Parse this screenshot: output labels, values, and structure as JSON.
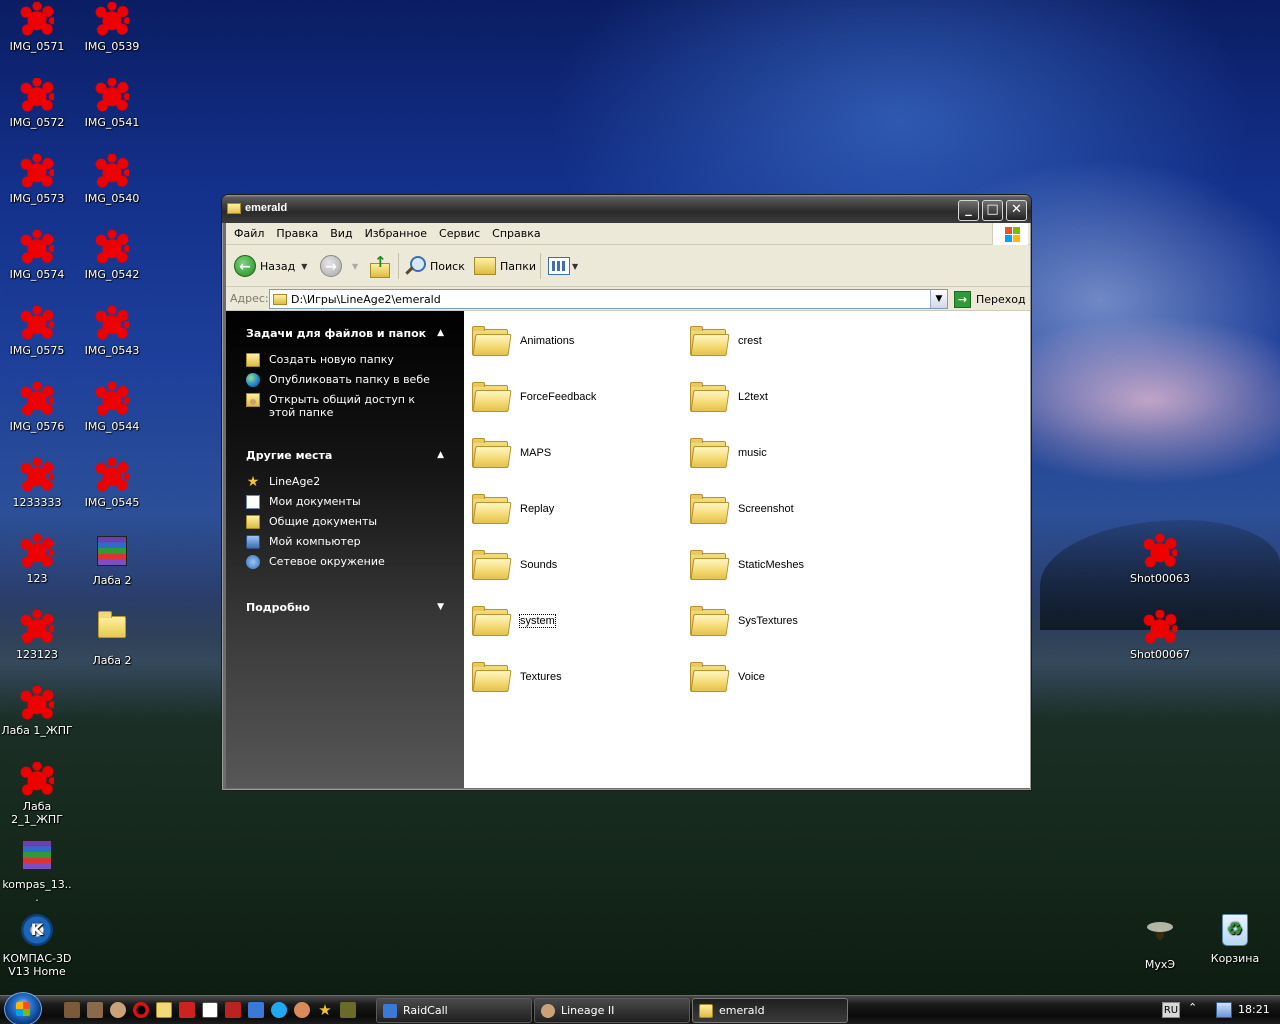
{
  "desktop": {
    "icons": [
      {
        "label": "IMG_0571",
        "icon": "image-icon"
      },
      {
        "label": "IMG_0539",
        "icon": "image-icon"
      },
      {
        "label": "IMG_0572",
        "icon": "image-icon"
      },
      {
        "label": "IMG_0541",
        "icon": "image-icon"
      },
      {
        "label": "IMG_0573",
        "icon": "image-icon"
      },
      {
        "label": "IMG_0540",
        "icon": "image-icon"
      },
      {
        "label": "IMG_0574",
        "icon": "image-icon"
      },
      {
        "label": "IMG_0542",
        "icon": "image-icon"
      },
      {
        "label": "IMG_0575",
        "icon": "image-icon"
      },
      {
        "label": "IMG_0543",
        "icon": "image-icon"
      },
      {
        "label": "IMG_0576",
        "icon": "image-icon"
      },
      {
        "label": "IMG_0544",
        "icon": "image-icon"
      },
      {
        "label": "1233333",
        "icon": "image-icon"
      },
      {
        "label": "IMG_0545",
        "icon": "image-icon"
      },
      {
        "label": "123",
        "icon": "image-icon"
      },
      {
        "label": "Лаба 2",
        "icon": "archive-icon"
      },
      {
        "label": "123123",
        "icon": "image-icon"
      },
      {
        "label": "Лаба 2",
        "icon": "folder-icon"
      },
      {
        "label": "Лаба 1_ЖПГ",
        "icon": "image-icon"
      },
      {
        "label": "Лаба 2_1_ЖПГ",
        "icon": "image-icon"
      },
      {
        "label": "kompas_13...",
        "icon": "archive-icon"
      },
      {
        "label": "КОМПАС-3D V13 Home",
        "icon": "kompas-icon"
      },
      {
        "label": "Shot00063",
        "icon": "image-icon"
      },
      {
        "label": "Shot00067",
        "icon": "image-icon"
      },
      {
        "label": "МухЭ",
        "icon": "fly-icon"
      },
      {
        "label": "Корзина",
        "icon": "recycle-bin-icon"
      }
    ]
  },
  "window": {
    "title": "emerald",
    "menu": [
      "Файл",
      "Правка",
      "Вид",
      "Избранное",
      "Сервис",
      "Справка"
    ],
    "toolbar": {
      "back_label": "Назад",
      "search_label": "Поиск",
      "folders_label": "Папки"
    },
    "address": {
      "label": "Адрес:",
      "value": "D:\\Игры\\LineAge2\\emerald",
      "go_label": "Переход"
    },
    "taskpane": {
      "file_tasks": {
        "title": "Задачи для файлов и папок",
        "items": [
          {
            "label": "Создать новую папку",
            "icon": "new-folder-icon"
          },
          {
            "label": "Опубликовать папку в вебе",
            "icon": "globe-icon"
          },
          {
            "label": "Открыть общий доступ к этой папке",
            "icon": "share-folder-icon"
          }
        ]
      },
      "other_places": {
        "title": "Другие места",
        "items": [
          {
            "label": "LineAge2",
            "icon": "star-folder-icon"
          },
          {
            "label": "Мои документы",
            "icon": "documents-icon"
          },
          {
            "label": "Общие документы",
            "icon": "shared-documents-icon"
          },
          {
            "label": "Мой компьютер",
            "icon": "computer-icon"
          },
          {
            "label": "Сетевое окружение",
            "icon": "network-icon"
          }
        ]
      },
      "details": {
        "title": "Подробно"
      }
    },
    "folders": [
      "Animations",
      "crest",
      "ForceFeedback",
      "L2text",
      "MAPS",
      "music",
      "Replay",
      "Screenshot",
      "Sounds",
      "StaticMeshes",
      "system",
      "SysTextures",
      "Textures",
      "Voice"
    ],
    "focused_folder": "system"
  },
  "taskbar": {
    "tasks": [
      {
        "label": "RaidCall",
        "icon": "raidcall-icon",
        "active": false
      },
      {
        "label": "Lineage II",
        "icon": "lineage-icon",
        "active": false
      },
      {
        "label": "emerald",
        "icon": "folder-icon",
        "active": true
      }
    ],
    "language": "RU",
    "clock": "18:21"
  },
  "colors": {
    "taskpane_bg": "#000000",
    "content_bg": "#ffffff",
    "toolbar_bg": "#ece9d8",
    "folder_yellow": "#f4d970"
  }
}
